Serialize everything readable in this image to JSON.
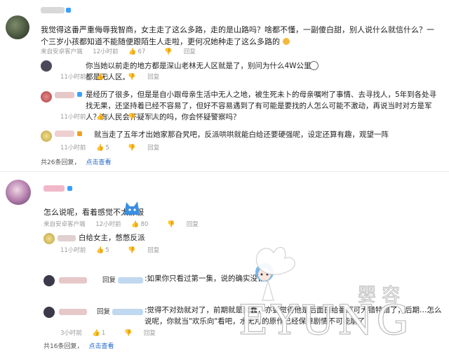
{
  "comments": [
    {
      "text": "我觉得这番严重侮辱我智商，女主走了这么多路，走的是山路吗？啥都不懂，一副傻白甜，别人说什么就信什么？一个三岁小孩都知道不能随便跟陌生人走啦，更何况她种走了这么多路的",
      "source": "来自安卓客户端",
      "time": "12小时前",
      "likes": "67",
      "reply": "回复",
      "replies": [
        {
          "text": "你当她以前走的地方都是深山老林无人区就是了，别问为什么4W公里都是无人区。",
          "time": "11小时前",
          "likes": "1",
          "reply": "回复"
        },
        {
          "text": "是经历了很多，但是是自小跟母亲生活中无人之地，被生死未卜的母亲嘱咐了事情、去寻找人，5年到各处寻找无果，还坚持着已经不容易了，但好不容易遇到了有可能是要找的人怎么可能不激动，再说当时对方是军人？有人民会怀疑军人的吗，你会怀疑警察吗？",
          "time": "11小时前",
          "likes": "5",
          "reply": "回复"
        },
        {
          "text": "就当走了五年才出她家那旮旯吧，反派哄哄就能白给还要硬强呢，设定还算有趣，观望一阵",
          "time": "11小时前",
          "likes": "5",
          "reply": "回复"
        }
      ],
      "summary": "共26条回复，",
      "summary_link": "点击查看"
    },
    {
      "text": "怎么说呢，看着感觉不太舒服",
      "source": "来自安卓客户端",
      "time": "12小时前",
      "likes": "80",
      "reply": "回复",
      "replies": [
        {
          "text": "白给女主，憋憋反派",
          "time": "11小时前",
          "likes": "5",
          "reply": "回复"
        },
        {
          "prefix": "回复",
          "text": ":如果你只看过第一集，说的确实没错。",
          "time": "",
          "likes": "",
          "reply": ""
        },
        {
          "prefix": "回复",
          "text": ":觉得不对劲就对了，前期就是卖蠢，亦要觉得他是后面白给番那可大错特错了，后期…怎么说呢，你就当\"欢乐向\"看吧，水无月的原作已经保障剧情不可能崩了",
          "time": "3小时前",
          "likes": "1",
          "reply": "回复"
        }
      ],
      "summary": "共16条回复，",
      "summary_link": "点击查看"
    }
  ],
  "watermark": {
    "big_text": "EYUNG",
    "cjk_text": "婴 容"
  },
  "colors": {
    "link": "#2266cc",
    "meta": "#999999",
    "badge_blue": "#3aa0ff",
    "badge_orange": "#f0a020"
  }
}
